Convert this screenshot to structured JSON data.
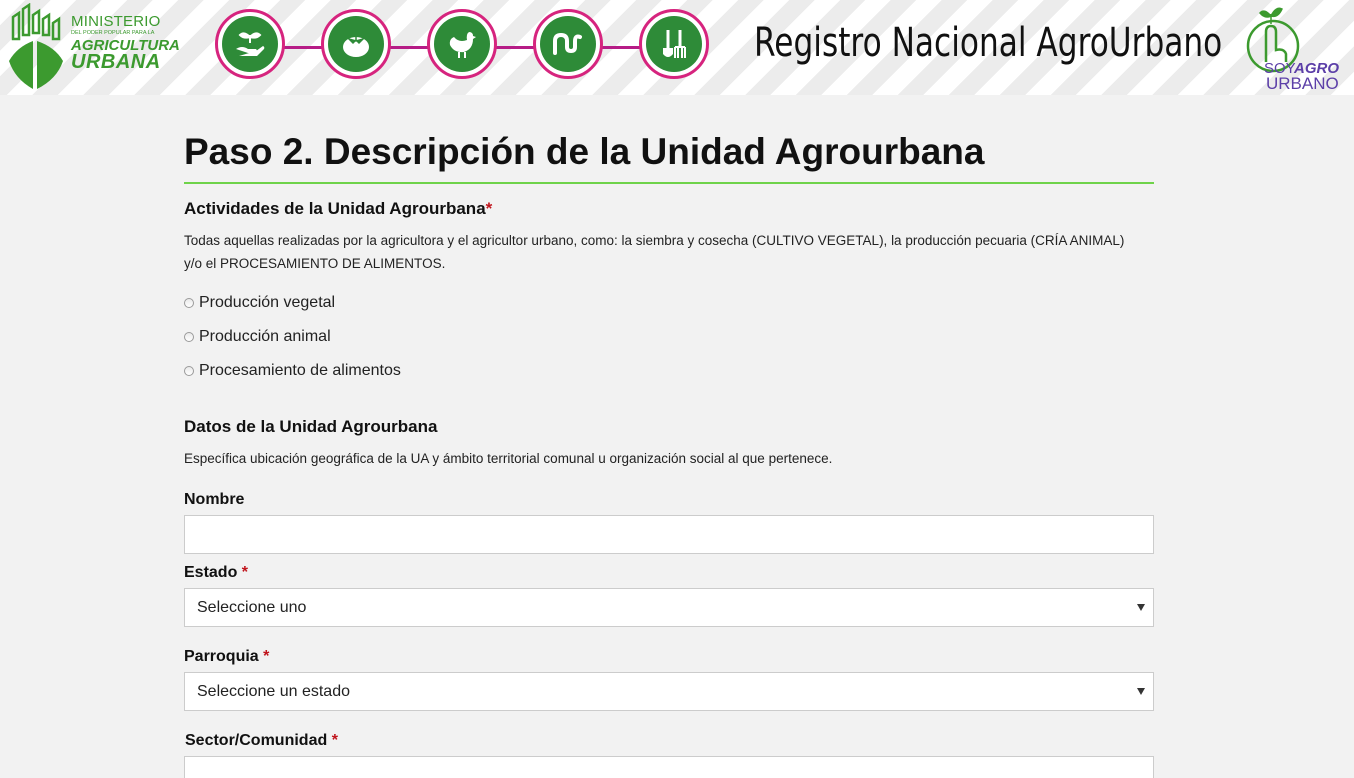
{
  "header": {
    "ministry_logo": {
      "line1": "MINISTERIO",
      "line2": "DEL PODER POPULAR PARA LA",
      "line3": "AGRICULTURA",
      "line4": "URBANA"
    },
    "steps": [
      {
        "icon": "hand-plant-icon"
      },
      {
        "icon": "tomato-icon"
      },
      {
        "icon": "hen-icon"
      },
      {
        "icon": "worm-icon"
      },
      {
        "icon": "garden-tools-icon"
      }
    ],
    "title": "Registro Nacional AgroUrbano",
    "soy_logo": {
      "soy": "SOY",
      "agro": "AGRO",
      "urbano": "URBANO"
    },
    "colors": {
      "green": "#2e8b38",
      "magenta": "#d6247e",
      "purple": "#5c3fa8"
    }
  },
  "main": {
    "page_title": "Paso 2. Descripción de la Unidad Agrourbana",
    "activities": {
      "title": "Actividades de la Unidad Agrourbana",
      "required_mark": "*",
      "description": "Todas aquellas realizadas por la agricultora y el agricultor urbano, como: la siembra y cosecha (CULTIVO VEGETAL), la producción pecuaria (CRÍA ANIMAL) y/o el PROCESAMIENTO DE ALIMENTOS.",
      "options": [
        "Producción vegetal",
        "Producción animal",
        "Procesamiento de alimentos"
      ]
    },
    "unit_data": {
      "title": "Datos de la Unidad Agrourbana",
      "description": "Específica ubicación geográfica de la UA y ámbito territorial comunal u organización social al que pertenece.",
      "fields": {
        "nombre_label": "Nombre",
        "nombre_value": "",
        "estado_label": "Estado",
        "estado_value": "Seleccione uno",
        "parroquia_label": "Parroquia",
        "parroquia_value": "Seleccione un estado",
        "sector_label": "Sector/Comunidad",
        "required_mark": "*"
      }
    }
  }
}
